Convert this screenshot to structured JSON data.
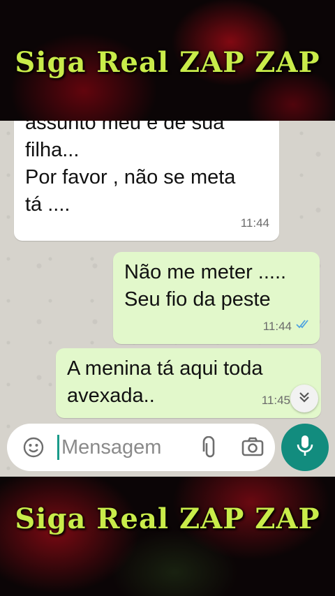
{
  "banner": {
    "top": "Siga Real ZAP ZAP",
    "bottom": "Siga Real ZAP ZAP",
    "color": "#c9ec4a"
  },
  "messages": [
    {
      "direction": "incoming",
      "text": "assunto meu e de sua\nfilha...\nPor favor , não se meta\ntá ....",
      "time": "11:44"
    },
    {
      "direction": "outgoing",
      "text": "Não me meter .....\nSeu fio da peste",
      "time": "11:44",
      "status_icon": "double-check-icon",
      "status_color": "#4fa3e0"
    },
    {
      "direction": "outgoing",
      "text": "A menina tá aqui toda\navexada..",
      "time": "11:45"
    }
  ],
  "input": {
    "placeholder": "Mensagem",
    "value": ""
  },
  "icons": {
    "emoji": "emoji-icon",
    "attach": "paperclip-icon",
    "camera": "camera-icon",
    "mic": "mic-icon",
    "scroll": "chevron-double-down-icon"
  },
  "colors": {
    "outgoing_bubble": "#e2f8cb",
    "incoming_bubble": "#ffffff",
    "mic_button": "#128c7e"
  }
}
